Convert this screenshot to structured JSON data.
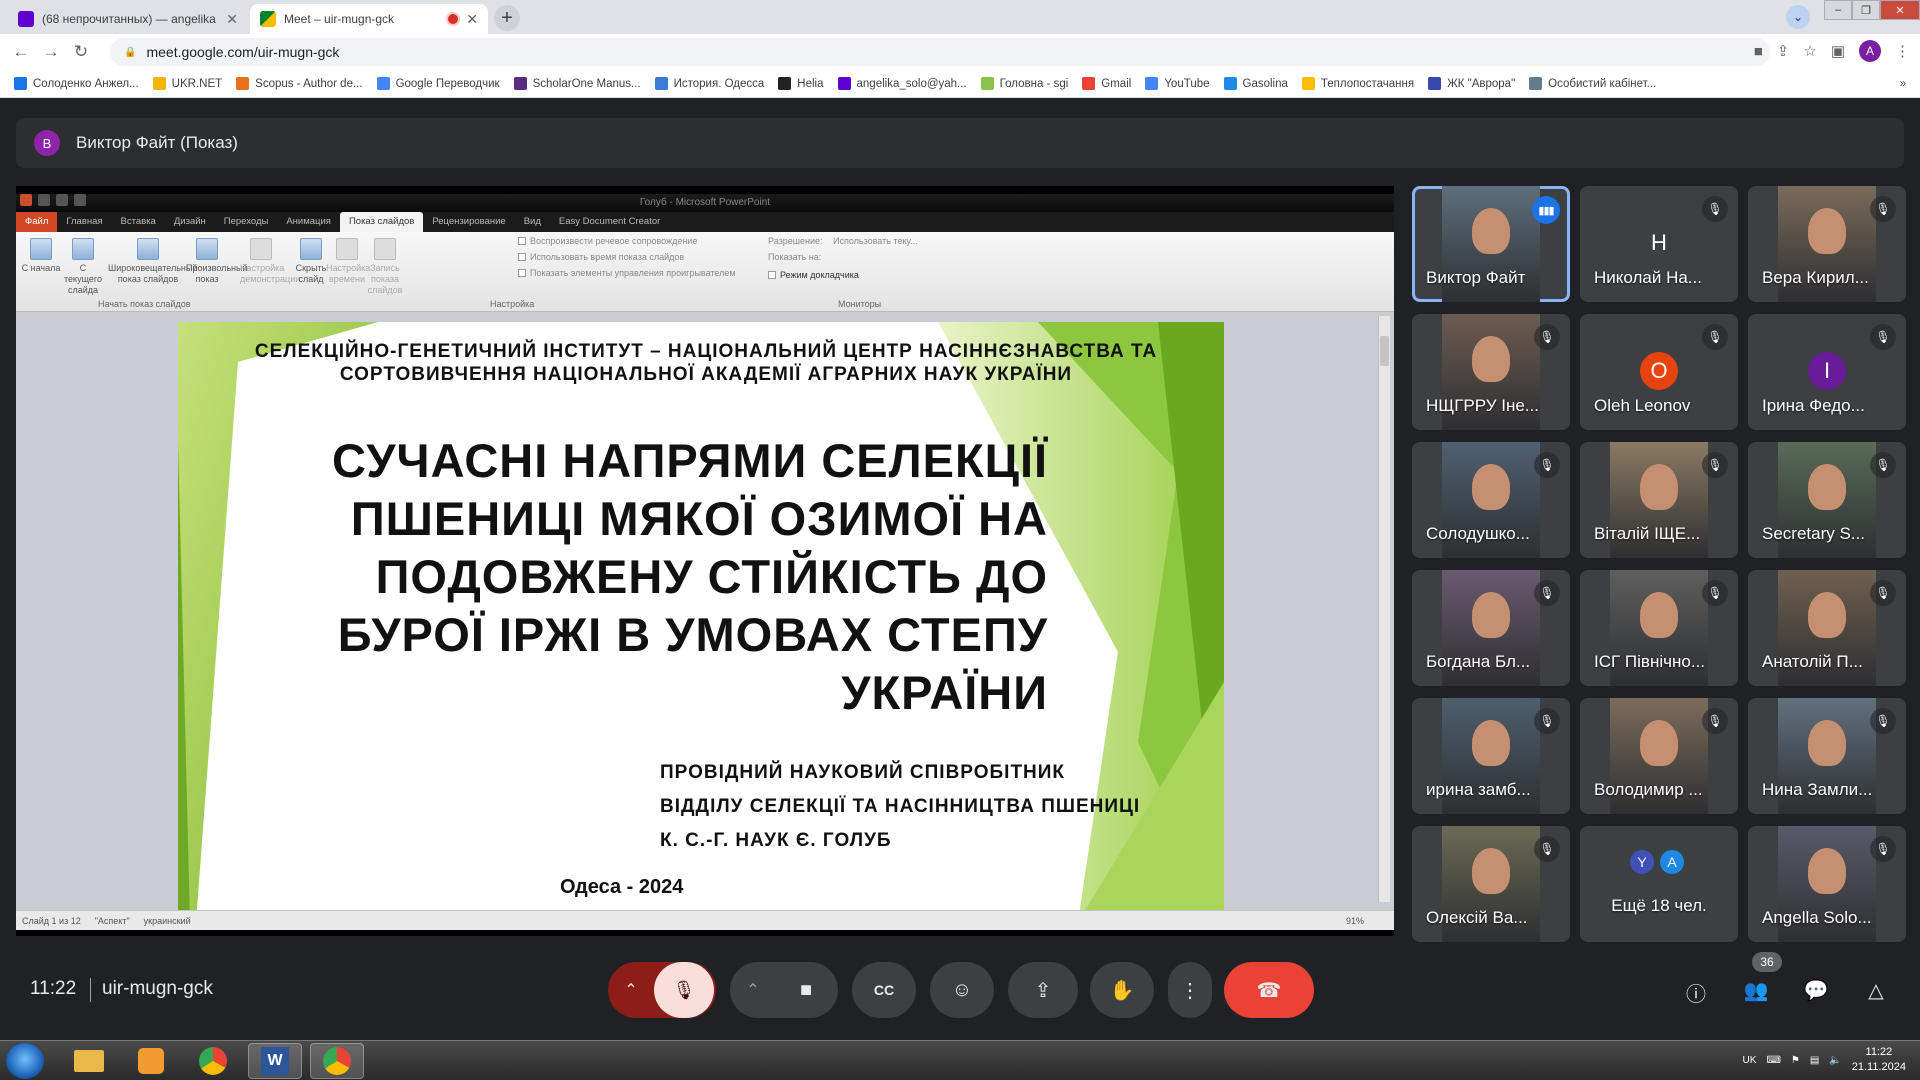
{
  "browser": {
    "tabs": [
      {
        "title": "(68 непрочитанных) — angelika",
        "active": false
      },
      {
        "title": "Meet – uir-mugn-gck",
        "active": true
      }
    ],
    "url": "meet.google.com/uir-mugn-gck",
    "profile_initial": "A",
    "bookmarks": [
      {
        "label": "Солоденко Анжел...",
        "icon": "person-icon",
        "color": "#1a73e8"
      },
      {
        "label": "UKR.NET",
        "icon": "ukrnet-icon",
        "color": "#f4b400"
      },
      {
        "label": "Scopus - Author de...",
        "icon": "scopus-icon",
        "color": "#e9711c"
      },
      {
        "label": "Google Переводчик",
        "icon": "translate-icon",
        "color": "#4285f4"
      },
      {
        "label": "ScholarOne Manus...",
        "icon": "scholarone-icon",
        "color": "#5b2c83"
      },
      {
        "label": "История. Одесса",
        "icon": "history-icon",
        "color": "#3a7bd5"
      },
      {
        "label": "Helia",
        "icon": "helia-icon",
        "color": "#222222"
      },
      {
        "label": "angelika_solo@yah...",
        "icon": "mail-icon",
        "color": "#6001d2"
      },
      {
        "label": "Головна - sgi",
        "icon": "sgi-icon",
        "color": "#8bc34a"
      },
      {
        "label": "Gmail",
        "icon": "gmail-icon",
        "color": "#ea4335"
      },
      {
        "label": "YouTube",
        "icon": "google-icon",
        "color": "#4285f4"
      },
      {
        "label": "Gasolina",
        "icon": "gasolina-icon",
        "color": "#1e88e5"
      },
      {
        "label": "Теплопостачання",
        "icon": "heat-icon",
        "color": "#fbbc05"
      },
      {
        "label": "ЖК \"Аврора\"",
        "icon": "aurora-icon",
        "color": "#3949ab"
      },
      {
        "label": "Особистий кабінет...",
        "icon": "cabinet-icon",
        "color": "#607d8b"
      }
    ]
  },
  "meet": {
    "presenter": {
      "initial": "В",
      "label": "Виктор Файт (Показ)"
    },
    "time": "11:22",
    "meeting_code": "uir-mugn-gck",
    "participant_count": "36",
    "more_people": {
      "label": "Ещё 18 чел.",
      "initials": [
        "Y",
        "A"
      ]
    },
    "participants": [
      {
        "name": "Виктор Файт",
        "type": "video",
        "speaking": true
      },
      {
        "name": "Николай На...",
        "type": "avatar",
        "initial": "Н",
        "color": "#3c4043"
      },
      {
        "name": "Вера Кирил...",
        "type": "video"
      },
      {
        "name": "НЩГРРУ Іне...",
        "type": "video"
      },
      {
        "name": "Oleh Leonov",
        "type": "avatar",
        "initial": "O",
        "color": "#e8430e"
      },
      {
        "name": "Ірина Федо...",
        "type": "avatar",
        "initial": "І",
        "color": "#6a1b9a"
      },
      {
        "name": "Солодушко...",
        "type": "video"
      },
      {
        "name": "Віталій ІЩЕ...",
        "type": "video"
      },
      {
        "name": "Secretary S...",
        "type": "video"
      },
      {
        "name": "Богдана Бл...",
        "type": "video"
      },
      {
        "name": "ІСГ Північно...",
        "type": "video"
      },
      {
        "name": "Анатолій П...",
        "type": "video"
      },
      {
        "name": "ирина замб...",
        "type": "video"
      },
      {
        "name": "Володимир ...",
        "type": "video"
      },
      {
        "name": "Нина Замли...",
        "type": "video"
      },
      {
        "name": "Олексій Ва...",
        "type": "video"
      },
      {
        "name": "Angella Solo...",
        "type": "video"
      }
    ]
  },
  "powerpoint": {
    "window_title": "Голуб - Microsoft PowerPoint",
    "tabs": [
      "Файл",
      "Главная",
      "Вставка",
      "Дизайн",
      "Переходы",
      "Анимация",
      "Показ слайдов",
      "Рецензирование",
      "Вид",
      "Easy Document Creator"
    ],
    "ribbon_buttons": [
      {
        "label": "С начала",
        "dim": false
      },
      {
        "label": "С текущего слайда",
        "dim": false
      },
      {
        "label": "Широковещательный показ слайдов",
        "dim": false
      },
      {
        "label": "Произвольный показ",
        "dim": false
      },
      {
        "label": "Настройка демонстрации",
        "dim": true
      },
      {
        "label": "Скрыть слайд",
        "dim": false
      },
      {
        "label": "Настройка времени",
        "dim": true
      },
      {
        "label": "Запись показа слайдов",
        "dim": true
      }
    ],
    "checkboxes": [
      "Воспроизвести речевое сопровождение",
      "Использовать время показа слайдов",
      "Показать элементы управления проигрывателем"
    ],
    "monitor_options": {
      "resolution": "Разрешение:",
      "resolution_value": "Использовать теку...",
      "show_on": "Показать на:",
      "presenter_mode": "Режим докладчика"
    },
    "groups": [
      "Начать показ слайдов",
      "Настройка",
      "Мониторы"
    ],
    "status": [
      "Слайд 1 из 12",
      "\"Аспект\"",
      "украинский"
    ],
    "zoom": "91%"
  },
  "slide": {
    "org": "СЕЛЕКЦІЙНО-ГЕНЕТИЧНИЙ ІНСТИТУТ – НАЦІОНАЛЬНИЙ ЦЕНТР НАСІННЄЗНАВСТВА ТА СОРТОВИВЧЕННЯ НАЦІОНАЛЬНОЇ АКАДЕМІЇ АГРАРНИХ НАУК УКРАЇНИ",
    "title_lines": [
      "СУЧАСНІ НАПРЯМИ СЕЛЕКЦІЇ",
      "ПШЕНИЦІ МЯКОЇ ОЗИМОЇ НА",
      "ПОДОВЖЕНУ СТІЙКІСТЬ ДО",
      "БУРОЇ ІРЖІ В УМОВАХ СТЕПУ",
      "УКРАЇНИ"
    ],
    "author_lines": [
      "ПРОВІДНИЙ НАУКОВИЙ СПІВРОБІТНИК",
      "ВІДДІЛУ СЕЛЕКЦІЇ ТА НАСІННИЦТВА ПШЕНИЦІ",
      "К. С.-Г. НАУК Є. ГОЛУБ"
    ],
    "city": "Одеса - 2024",
    "accent": "#8dc63f"
  },
  "taskbar": {
    "lang": "UK",
    "time": "11:22",
    "date": "21.11.2024"
  }
}
